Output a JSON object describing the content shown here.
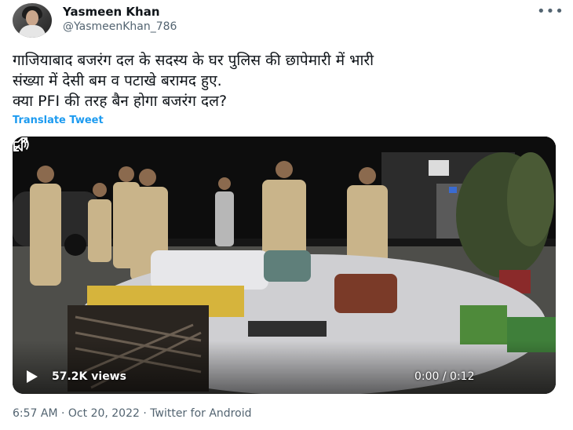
{
  "author": {
    "name": "Yasmeen Khan",
    "handle": "@YasmeenKhan_786"
  },
  "more_icon": "•••",
  "tweet": {
    "lines": [
      "गाजियाबाद बजरंग दल के सदस्य के घर पुलिस की छापेमारी में भारी",
      "संख्या में देसी बम व पटाखे बरामद हुए.",
      "क्या PFI की तरह बैन होगा बजरंग दल?"
    ],
    "translate_label": "Translate Tweet"
  },
  "video": {
    "views": "57.2K views",
    "time": "0:00 / 0:12",
    "icons": [
      "play-icon",
      "volume-icon",
      "fullscreen-icon"
    ]
  },
  "footer": {
    "time": "6:57 AM",
    "date": "Oct 20, 2022",
    "source": "Twitter for Android",
    "separator": "·"
  },
  "colors": {
    "link": "#1d9bf0",
    "muted": "#536471",
    "text": "#0f1419"
  }
}
